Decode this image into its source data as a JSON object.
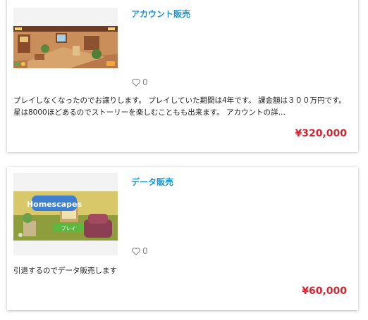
{
  "listings": [
    {
      "title": "アカウント販売",
      "likes": "0",
      "description": "プレイしなくなったのでお譲りします。 プレイしていた期間は4年です。 課金額は３００万円です。 星は8000ほどあるのでストーリーを楽しむこともも出来ます。 アカウントの詳…",
      "price": "¥320,000",
      "image": "game-room-screenshot"
    },
    {
      "title": "データ販売",
      "likes": "0",
      "description": "引退するのでデータ販売します",
      "price": "¥60,000",
      "image": "homescapes-screenshot",
      "image_text": {
        "logo": "Homescapes",
        "button": "プレイ"
      }
    }
  ],
  "colors": {
    "title": "#1a96d2",
    "price": "#d9232d",
    "text": "#222222",
    "muted": "#888888"
  },
  "icons": {
    "like": "heart-outline-icon"
  }
}
